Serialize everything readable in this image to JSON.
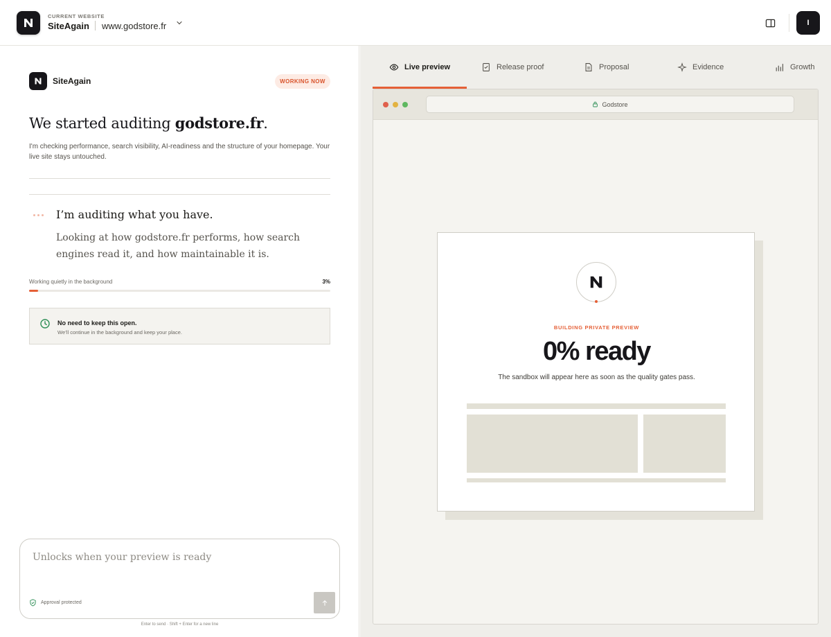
{
  "header": {
    "current_website_label": "CURRENT WEBSITE",
    "site_name": "SiteAgain",
    "domain": "www.godstore.fr",
    "user_initial": "I"
  },
  "left": {
    "brand_name": "SiteAgain",
    "status_badge": "WORKING NOW",
    "headline_prefix": "We started auditing",
    "headline_domain": "godstore.fr",
    "headline_suffix": ".",
    "subtext": "I'm checking performance, search visibility, AI-readiness and the structure of your homepage. Your live site stays untouched.",
    "step_title": "I’m auditing what you have.",
    "step_description": "Looking at how godstore.fr performs, how search engines read it, and how maintainable it is.",
    "progress_label": "Working quietly in the background",
    "progress_value_text": "3%",
    "progress_fraction": 0.03,
    "note_title": "No need to keep this open.",
    "note_subtitle": "We’ll continue in the background and keep your place.",
    "composer_placeholder": "Unlocks when your preview is ready",
    "approval_label": "Approval protected",
    "hint": "Enter to send · Shift + Enter for a new line"
  },
  "right": {
    "tabs": [
      {
        "label": "Live preview",
        "icon": "eye-icon",
        "active": true
      },
      {
        "label": "Release proof",
        "icon": "checklist-icon",
        "active": false
      },
      {
        "label": "Proposal",
        "icon": "document-icon",
        "active": false
      },
      {
        "label": "Evidence",
        "icon": "sparkle-icon",
        "active": false
      },
      {
        "label": "Growth",
        "icon": "bar-chart-icon",
        "active": false
      }
    ],
    "browser": {
      "url_label": "Godstore",
      "building_label": "BUILDING PRIVATE PREVIEW",
      "ready_text": "0% ready",
      "ready_subtext": "The sandbox will appear here as soon as the quality gates pass."
    }
  },
  "colors": {
    "accent": "#e55f36",
    "dark": "#17161a",
    "traffic_red": "#e0604c",
    "traffic_yellow": "#e3b341",
    "traffic_green": "#5fb860",
    "success_green": "#2f8f57"
  }
}
